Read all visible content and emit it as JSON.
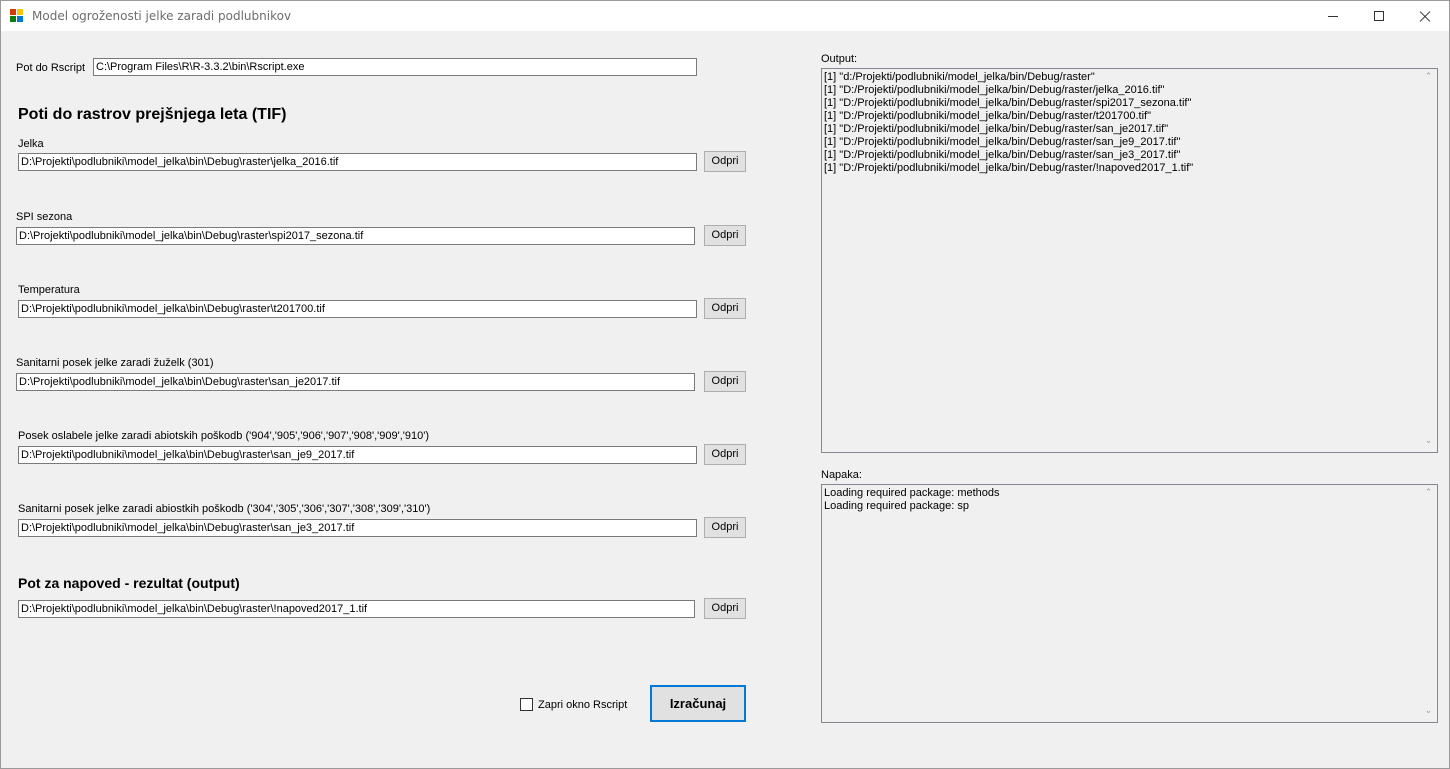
{
  "window": {
    "title": "Model ogroženosti jelke zaradi podlubnikov"
  },
  "icons": {
    "app": "app-icon",
    "minimize": "minimize-icon",
    "maximize": "maximize-icon",
    "close": "close-icon"
  },
  "rscript": {
    "label": "Pot do Rscript",
    "value": "C:\\Program Files\\R\\R-3.3.2\\bin\\Rscript.exe"
  },
  "heading_input": "Poti do rastrov prejšnjega leta (TIF)",
  "heading_output": "Pot za napoved - rezultat (output)",
  "open_label": "Odpri",
  "fields": [
    {
      "label": "Jelka",
      "value": "D:\\Projekti\\podlubniki\\model_jelka\\bin\\Debug\\raster\\jelka_2016.tif"
    },
    {
      "label": "SPI sezona",
      "value": "D:\\Projekti\\podlubniki\\model_jelka\\bin\\Debug\\raster\\spi2017_sezona.tif"
    },
    {
      "label": "Temperatura",
      "value": "D:\\Projekti\\podlubniki\\model_jelka\\bin\\Debug\\raster\\t201700.tif"
    },
    {
      "label": "Sanitarni posek jelke zaradi žuželk (301)",
      "value": "D:\\Projekti\\podlubniki\\model_jelka\\bin\\Debug\\raster\\san_je2017.tif"
    },
    {
      "label": "Posek oslabele jelke zaradi abiotskih poškodb ('904','905','906','907','908','909','910')",
      "value": "D:\\Projekti\\podlubniki\\model_jelka\\bin\\Debug\\raster\\san_je9_2017.tif"
    },
    {
      "label": "Sanitarni posek jelke zaradi abiostkih poškodb ('304','305','306','307','308','309','310')",
      "value": "D:\\Projekti\\podlubniki\\model_jelka\\bin\\Debug\\raster\\san_je3_2017.tif"
    }
  ],
  "output_path": {
    "value": "D:\\Projekti\\podlubniki\\model_jelka\\bin\\Debug\\raster\\!napoved2017_1.tif"
  },
  "close_rscript": {
    "label": "Zapri okno Rscript",
    "checked": false
  },
  "compute_label": "Izračunaj",
  "output_panel": {
    "label": "Output:",
    "lines": [
      "[1] \"d:/Projekti/podlubniki/model_jelka/bin/Debug/raster\"",
      "[1] \"D:/Projekti/podlubniki/model_jelka/bin/Debug/raster/jelka_2016.tif\"",
      "[1] \"D:/Projekti/podlubniki/model_jelka/bin/Debug/raster/spi2017_sezona.tif\"",
      "[1] \"D:/Projekti/podlubniki/model_jelka/bin/Debug/raster/t201700.tif\"",
      "[1] \"D:/Projekti/podlubniki/model_jelka/bin/Debug/raster/san_je2017.tif\"",
      "[1] \"D:/Projekti/podlubniki/model_jelka/bin/Debug/raster/san_je9_2017.tif\"",
      "[1] \"D:/Projekti/podlubniki/model_jelka/bin/Debug/raster/san_je3_2017.tif\"",
      "[1] \"D:/Projekti/podlubniki/model_jelka/bin/Debug/raster/!napoved2017_1.tif\""
    ]
  },
  "error_panel": {
    "label": "Napaka:",
    "lines": [
      "Loading required package: methods",
      "Loading required package: sp"
    ]
  }
}
